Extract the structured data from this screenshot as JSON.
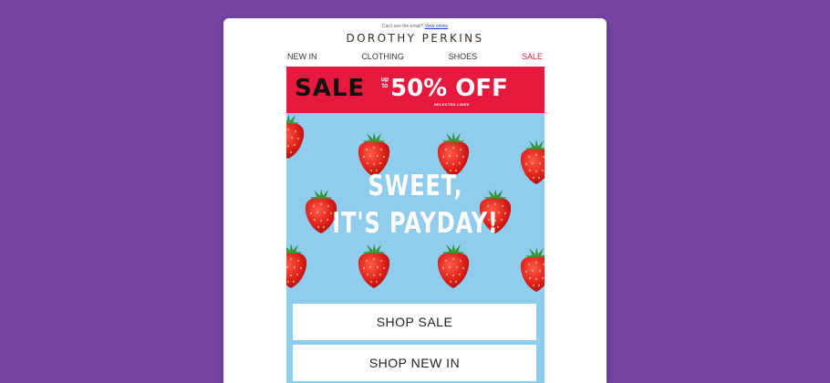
{
  "email": {
    "preheader_text": "Can't see the email?",
    "preheader_link": "View online",
    "brand": "DOROTHY PERKINS",
    "nav": [
      {
        "label": "NEW IN"
      },
      {
        "label": "CLOTHING"
      },
      {
        "label": "SHOES"
      },
      {
        "label": "SALE"
      }
    ],
    "banner": {
      "sale": "SALE",
      "upto_1": "up",
      "upto_2": "to",
      "discount": "50% OFF",
      "note": "SELECTED LINES"
    },
    "hero": {
      "line1": "SWEET,",
      "line2": "IT'S PAYDAY!"
    },
    "cta": {
      "shop_sale": "SHOP SALE",
      "shop_new_in": "SHOP NEW IN"
    }
  },
  "colors": {
    "background": "#7545a3",
    "banner": "#e8193f",
    "hero_bg": "#8fcdef",
    "sale_nav": "#e01b3c"
  }
}
